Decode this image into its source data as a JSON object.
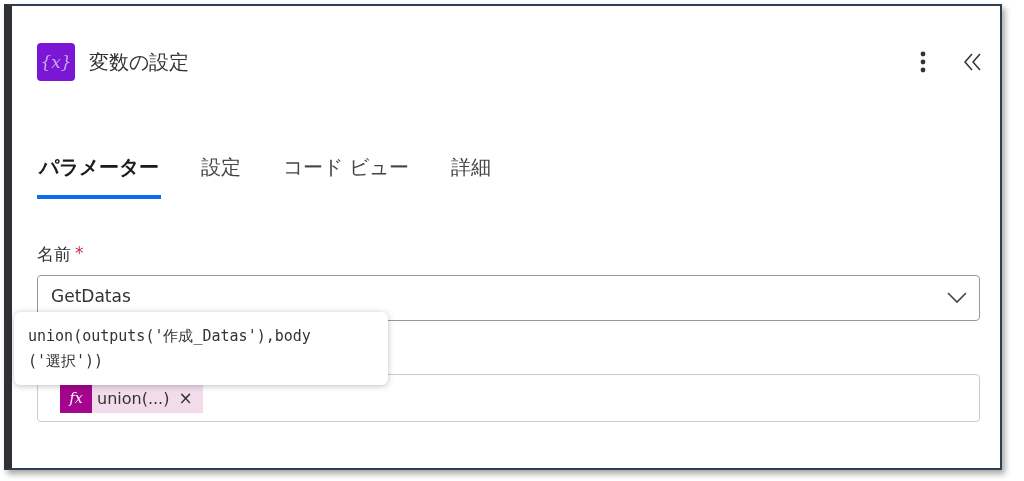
{
  "header": {
    "title": "変数の設定",
    "icon_text": "{x}"
  },
  "tabs": [
    {
      "label": "パラメーター",
      "selected": true
    },
    {
      "label": "設定",
      "selected": false
    },
    {
      "label": "コード ビュー",
      "selected": false
    },
    {
      "label": "詳細",
      "selected": false
    }
  ],
  "fields": [
    {
      "kind": "dropdown",
      "label": "名前",
      "required": true,
      "required_mark": "*",
      "value": "GetDatas"
    },
    {
      "kind": "token",
      "token_icon": "fx",
      "token_label": "union(...)",
      "remove": "×"
    }
  ],
  "tooltip": {
    "lines": [
      "union(outputs('作成_Datas'),body",
      "('選択'))"
    ]
  }
}
